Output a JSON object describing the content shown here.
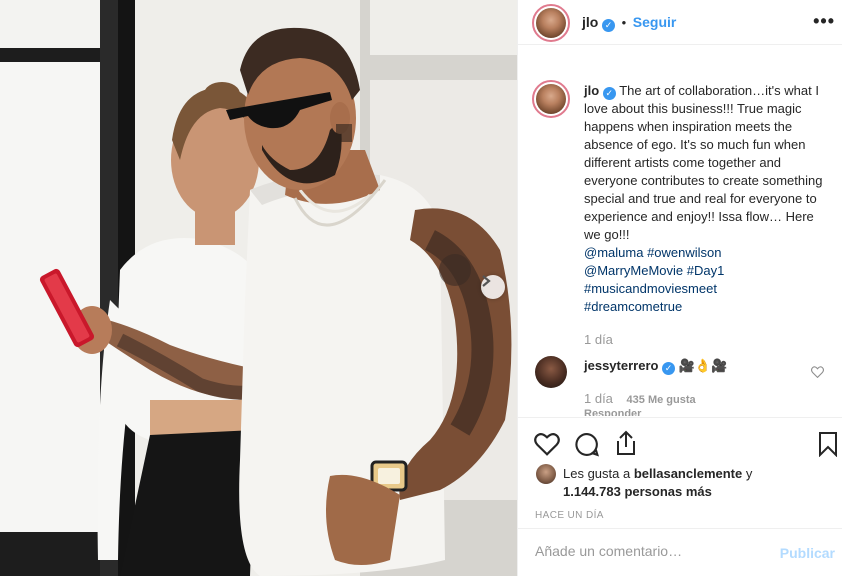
{
  "post": {
    "username": "jlo",
    "follow_label": "Seguir",
    "more_icon": "more-options-icon",
    "verified_icon": "verified-badge-icon"
  },
  "caption": {
    "username": "jlo",
    "text": "The art of collaboration…it's what I love about this business!!! True magic happens when inspiration meets the absence of ego. It's so much fun when different artists come together and everyone contributes to create something special and true and real for everyone to experience and enjoy!! Issa flow… Here we go!!!",
    "tags": [
      "@maluma",
      "#owenwilson",
      "@MarryMeMovie",
      "#Day1",
      "#musicandmoviesmeet",
      "#dreamcometrue"
    ],
    "time": "1 día"
  },
  "comment": {
    "username": "jessyterrero",
    "emoji": "🎥👌🎥",
    "time": "1 día",
    "likes": "435 Me gusta",
    "reply": "Responder"
  },
  "actions": {
    "like_icon": "heart-icon",
    "comment_icon": "comment-bubble-icon",
    "share_icon": "share-icon",
    "save_icon": "bookmark-icon"
  },
  "likes": {
    "prefix": "Les gusta a",
    "user": "bellasanclemente",
    "connector": "y",
    "count": "1.144.783 personas más"
  },
  "time_ago": "HACE UN DÍA",
  "add_comment": {
    "placeholder": "Añade un comentario…",
    "publish_label": "Publicar"
  },
  "colors": {
    "link_blue": "#3897f0",
    "hashtag_blue": "#003569",
    "muted": "#999999",
    "publish_disabled": "#b3dbff"
  }
}
